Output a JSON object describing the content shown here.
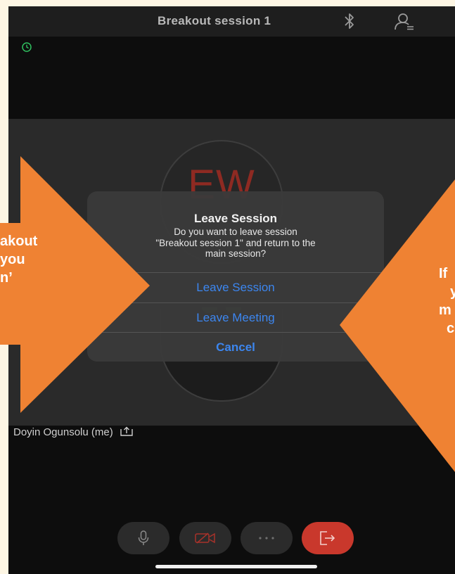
{
  "header": {
    "title": "Breakout session 1"
  },
  "video": {
    "avatar_initials": "EW",
    "participant_name": "Doyin Ogunsolu (me)"
  },
  "dialog": {
    "title": "Leave Session",
    "message_line1": "Do you want to leave session",
    "message_line2": "\"Breakout session 1\" and return to the",
    "message_line3": "main session?",
    "leave_session": "Leave Session",
    "leave_meeting": "Leave Meeting",
    "cancel": "Cancel"
  },
  "annotations": {
    "left_line1": "akout",
    "left_line2": "you",
    "left_line3": "n’",
    "right_line1": "If",
    "right_line2": "y",
    "right_line3": "m",
    "right_line4": "c"
  },
  "colors": {
    "accent": "#3c86ef",
    "annotation": "#ef8233",
    "end_button": "#c9382c",
    "avatar_text": "#8e2a22"
  },
  "icons": {
    "bluetooth": "bluetooth-icon",
    "participants": "participants-icon",
    "clock": "clock-icon",
    "mic": "microphone-icon",
    "video_off": "video-off-icon",
    "more": "more-icon",
    "leave": "leave-icon",
    "share": "share-icon"
  }
}
